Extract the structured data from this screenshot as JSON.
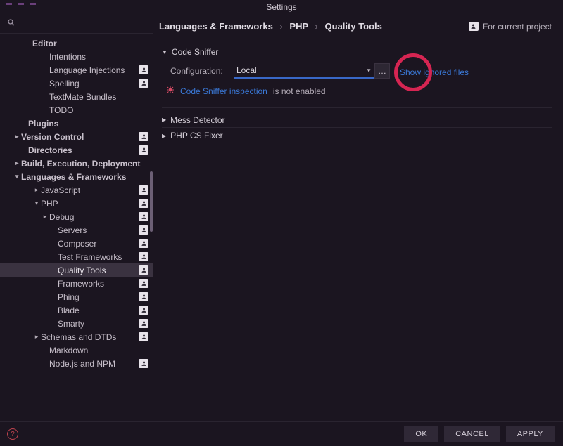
{
  "window": {
    "title": "Settings"
  },
  "sidebar": {
    "search_placeholder": "",
    "items": [
      {
        "label": "Editor",
        "bold": true,
        "arrow": "",
        "indent": "ind1",
        "badge": false
      },
      {
        "label": "Intentions",
        "arrow": "",
        "indent": "ind2b",
        "badge": false
      },
      {
        "label": "Language Injections",
        "arrow": "",
        "indent": "ind2b",
        "badge": true
      },
      {
        "label": "Spelling",
        "arrow": "",
        "indent": "ind2b",
        "badge": true
      },
      {
        "label": "TextMate Bundles",
        "arrow": "",
        "indent": "ind2b",
        "badge": false
      },
      {
        "label": "TODO",
        "arrow": "",
        "indent": "ind2b",
        "badge": false
      },
      {
        "label": "Plugins",
        "bold": true,
        "arrow": "",
        "indent": "ind0c",
        "badge": false
      },
      {
        "label": "Version Control",
        "bold": true,
        "arrow": "▸",
        "indent": "ind0b",
        "badge": true
      },
      {
        "label": "Directories",
        "bold": true,
        "arrow": "",
        "indent": "ind0c",
        "badge": true
      },
      {
        "label": "Build, Execution, Deployment",
        "bold": true,
        "arrow": "▸",
        "indent": "ind0b",
        "badge": false
      },
      {
        "label": "Languages & Frameworks",
        "bold": true,
        "arrow": "▾",
        "indent": "ind0b",
        "badge": false
      },
      {
        "label": "JavaScript",
        "arrow": "▸",
        "indent": "ind2",
        "badge": true
      },
      {
        "label": "PHP",
        "arrow": "▾",
        "indent": "ind2",
        "badge": true
      },
      {
        "label": "Debug",
        "arrow": "▸",
        "indent": "ind3",
        "badge": true
      },
      {
        "label": "Servers",
        "arrow": "",
        "indent": "ind3b",
        "badge": true
      },
      {
        "label": "Composer",
        "arrow": "",
        "indent": "ind3b",
        "badge": true
      },
      {
        "label": "Test Frameworks",
        "arrow": "",
        "indent": "ind3b",
        "badge": true
      },
      {
        "label": "Quality Tools",
        "arrow": "",
        "indent": "ind3b",
        "badge": true,
        "selected": true
      },
      {
        "label": "Frameworks",
        "arrow": "",
        "indent": "ind3b",
        "badge": true
      },
      {
        "label": "Phing",
        "arrow": "",
        "indent": "ind3b",
        "badge": true
      },
      {
        "label": "Blade",
        "arrow": "",
        "indent": "ind3b",
        "badge": true
      },
      {
        "label": "Smarty",
        "arrow": "",
        "indent": "ind3b",
        "badge": true
      },
      {
        "label": "Schemas and DTDs",
        "arrow": "▸",
        "indent": "ind2",
        "badge": true
      },
      {
        "label": "Markdown",
        "arrow": "",
        "indent": "ind2b",
        "badge": false
      },
      {
        "label": "Node.js and NPM",
        "arrow": "",
        "indent": "ind2b",
        "badge": true
      }
    ]
  },
  "breadcrumb": {
    "a": "Languages & Frameworks",
    "b": "PHP",
    "c": "Quality Tools"
  },
  "scope_text": "For current project",
  "sections": {
    "code_sniffer": {
      "title": "Code Sniffer",
      "config_label": "Configuration:",
      "config_value": "Local",
      "ignored_link": "Show ignored files",
      "inspection_link": "Code Sniffer inspection",
      "inspection_suffix": "is not enabled"
    },
    "mess": {
      "title": "Mess Detector"
    },
    "csfixer": {
      "title": "PHP CS Fixer"
    }
  },
  "buttons": {
    "ok": "OK",
    "cancel": "CANCEL",
    "apply": "APPLY"
  }
}
